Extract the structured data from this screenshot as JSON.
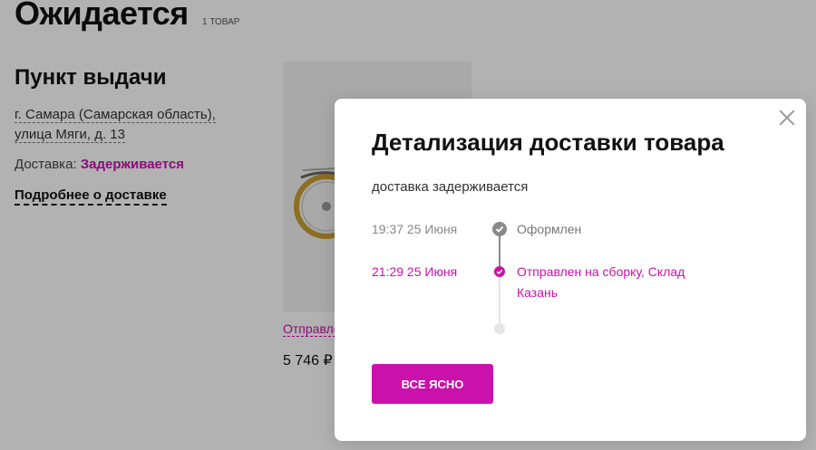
{
  "page": {
    "title": "Ожидается",
    "count": "1 ТОВАР",
    "pickup": {
      "heading": "Пункт выдачи",
      "address": "г. Самара (Самарская область), улица Мяги, д. 13",
      "delivery_label": "Доставка:",
      "delivery_status": "Задерживается",
      "details_link": "Подробнее о доставке"
    },
    "product": {
      "status": "Отправлен на сборку",
      "price": "5 746 ₽"
    }
  },
  "modal": {
    "title": "Детализация доставки товара",
    "subtitle": "доставка задерживается",
    "timeline": [
      {
        "time": "19:37 25 Июня",
        "status": "Оформлен",
        "state": "done"
      },
      {
        "time": "21:29 25 Июня",
        "status": "Отправлен на сборку, Склад Казань",
        "state": "current"
      },
      {
        "time": "",
        "status": "",
        "state": "pending"
      }
    ],
    "ok_button": "ВСЕ ЯСНО",
    "close_icon": "close-icon"
  },
  "colors": {
    "accent": "#cb11ab",
    "muted": "#8a8a8a",
    "overlay": "rgba(0,0,0,0.30)"
  }
}
